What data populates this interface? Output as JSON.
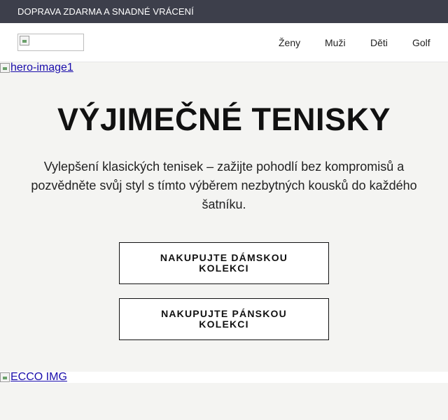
{
  "topbar": {
    "text": "DOPRAVA ZDARMA A SNADNÉ VRÁCENÍ"
  },
  "nav": {
    "items": [
      {
        "label": "Ženy"
      },
      {
        "label": "Muži"
      },
      {
        "label": "Děti"
      },
      {
        "label": "Golf"
      }
    ]
  },
  "hero": {
    "image_alt": "hero-image1",
    "title": "VÝJIMEČNÉ TENISKY",
    "text": "Vylepšení klasických tenisek – zažijte pohodlí bez kompromisů a pozvědněte svůj styl s tímto výběrem nezbytných kousků do každého šatníku.",
    "button_women": "NAKUPUJTE DÁMSKOU KOLEKCI",
    "button_men": "NAKUPUJTE PÁNSKOU KOLEKCI"
  },
  "section2": {
    "image_alt": "ECCO IMG"
  },
  "colors": {
    "topbar_bg": "#3d3f4b",
    "page_bg": "#f4f4f2",
    "link": "#1a0dab"
  },
  "icons": [
    "broken-image-icon"
  ]
}
